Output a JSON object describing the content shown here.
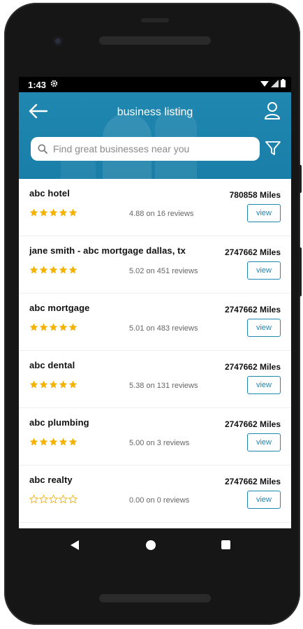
{
  "status_bar": {
    "time": "1:43",
    "settings_icon": "gear-icon",
    "signal_icons": [
      "wifi-icon",
      "cell-signal-icon",
      "battery-icon"
    ]
  },
  "header": {
    "title": "business listing",
    "back_icon": "arrow-left-icon",
    "profile_icon": "user-icon",
    "filter_icon": "filter-icon",
    "background_color": "#1f87b0"
  },
  "search": {
    "placeholder": "Find great businesses near you",
    "value": "",
    "icon": "search-icon"
  },
  "listings": [
    {
      "name": "abc hotel",
      "distance": "780858 Miles",
      "stars": 5,
      "rating_text": "4.88 on 16 reviews",
      "view_label": "view"
    },
    {
      "name": "jane smith - abc mortgage dallas, tx",
      "distance": "2747662 Miles",
      "stars": 5,
      "rating_text": "5.02 on 451 reviews",
      "view_label": "view"
    },
    {
      "name": "abc mortgage",
      "distance": "2747662 Miles",
      "stars": 5,
      "rating_text": "5.01 on 483 reviews",
      "view_label": "view"
    },
    {
      "name": "abc dental",
      "distance": "2747662 Miles",
      "stars": 5,
      "rating_text": "5.38 on 131 reviews",
      "view_label": "view"
    },
    {
      "name": "abc plumbing",
      "distance": "2747662 Miles",
      "stars": 5,
      "rating_text": "5.00 on 3 reviews",
      "view_label": "view"
    },
    {
      "name": "abc realty",
      "distance": "2747662 Miles",
      "stars": 0,
      "rating_text": "0.00 on 0 reviews",
      "view_label": "view"
    }
  ],
  "colors": {
    "accent": "#1f87b0",
    "star_filled": "#f5b301",
    "star_empty": "#f5b301"
  },
  "nav_bar": {
    "back_icon": "nav-back-icon",
    "home_icon": "nav-home-icon",
    "recents_icon": "nav-recents-icon"
  }
}
